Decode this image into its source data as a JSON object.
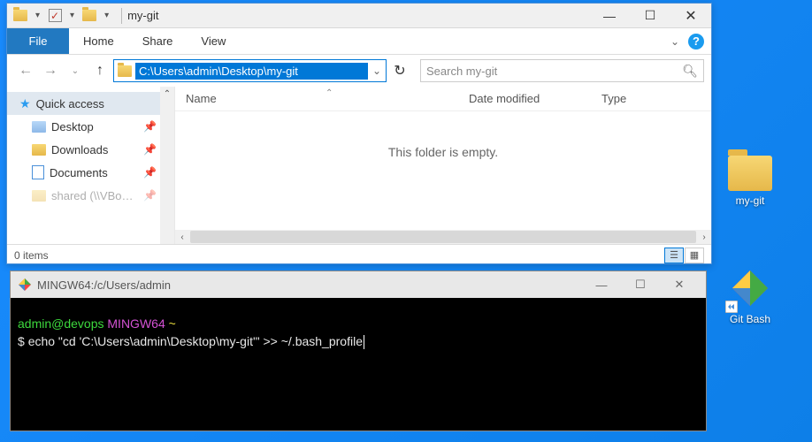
{
  "explorer": {
    "title": "my-git",
    "file_tab": "File",
    "tabs": [
      "Home",
      "Share",
      "View"
    ],
    "address_path": "C:\\Users\\admin\\Desktop\\my-git",
    "search_placeholder": "Search my-git",
    "nav_pane": {
      "quick_access": "Quick access",
      "items": [
        {
          "label": "Desktop",
          "pinned": true,
          "icon": "folder-blue"
        },
        {
          "label": "Downloads",
          "pinned": true,
          "icon": "folder"
        },
        {
          "label": "Documents",
          "pinned": true,
          "icon": "doc"
        },
        {
          "label": "shared (\\\\VBo…",
          "pinned": true,
          "icon": "folder"
        }
      ]
    },
    "columns": {
      "name": "Name",
      "date": "Date modified",
      "type": "Type"
    },
    "empty_message": "This folder is empty.",
    "status": "0 items"
  },
  "terminal": {
    "title": "MINGW64:/c/Users/admin",
    "prompt_user": "admin@devops",
    "prompt_sys": "MINGW64",
    "prompt_path": "~",
    "command": "echo \"cd 'C:\\Users\\admin\\Desktop\\my-git'\" >> ~/.bash_profile"
  },
  "desktop": {
    "folder_label": "my-git",
    "gitbash_label": "Git Bash"
  }
}
